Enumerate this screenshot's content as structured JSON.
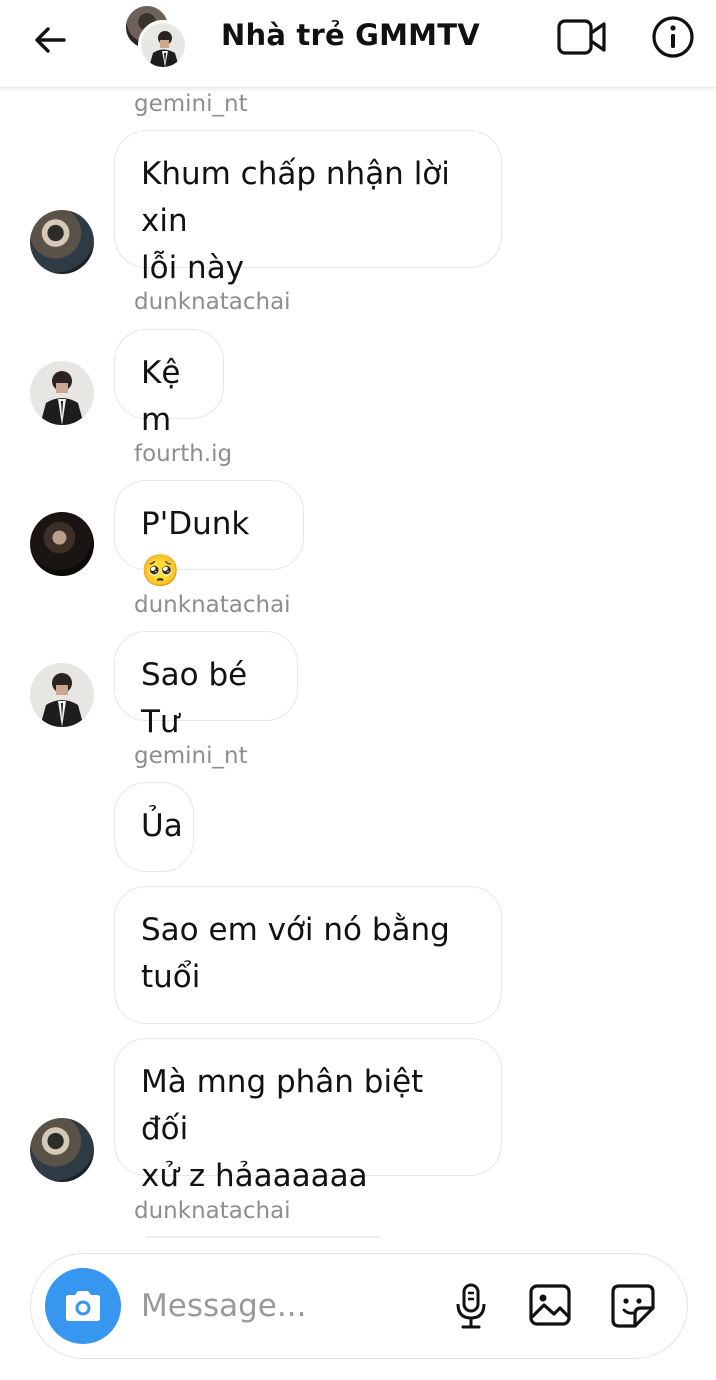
{
  "header": {
    "title": "Nhà trẻ GMMTV",
    "icons": {
      "back": "arrow-left-icon",
      "video": "video-call-icon",
      "info": "info-icon"
    }
  },
  "messages": [
    {
      "sender": "gemini_nt",
      "lines": [
        "Khum chấp nhận lời xin",
        "lỗi này"
      ]
    },
    {
      "sender": "dunknatachai",
      "lines": [
        "Kệ m"
      ]
    },
    {
      "sender": "fourth.ig",
      "lines": [
        "P'Dunk🥺"
      ]
    },
    {
      "sender": "dunknatachai",
      "lines": [
        "Sao bé Tư"
      ]
    },
    {
      "sender": "gemini_nt",
      "lines": [
        "Ủa"
      ]
    },
    {
      "sender": "gemini_nt",
      "lines": [
        "Sao em với nó bằng",
        "tuổi"
      ]
    },
    {
      "sender": "gemini_nt",
      "lines": [
        "Mà mng phân biệt đối",
        "xử z hảaaaaaa"
      ]
    },
    {
      "sender": "dunknatachai",
      "lines": []
    }
  ],
  "composer": {
    "placeholder": "Message...",
    "icons": {
      "camera": "camera-icon",
      "mic": "microphone-icon",
      "gallery": "image-icon",
      "sticker": "sticker-icon"
    }
  },
  "colors": {
    "accent": "#3797f0",
    "username": "#8e8e8e",
    "bubble_border": "#e7e7e7"
  }
}
